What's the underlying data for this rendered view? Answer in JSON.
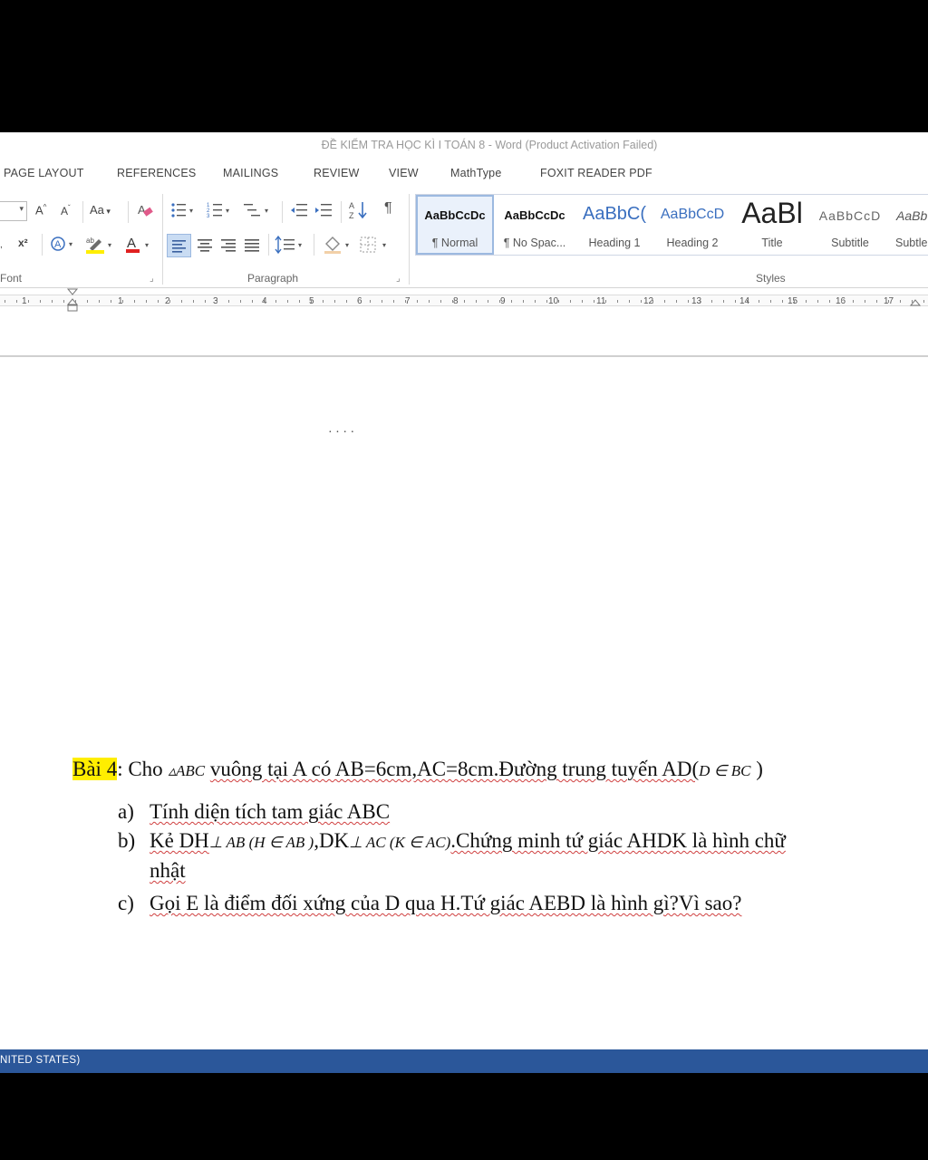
{
  "window": {
    "title": "ĐỀ KIỂM TRA HỌC KÌ I TOÁN 8 - Word (Product Activation Failed)"
  },
  "tabs": [
    "PAGE LAYOUT",
    "REFERENCES",
    "MAILINGS",
    "REVIEW",
    "VIEW",
    "MathType",
    "FOXIT READER PDF"
  ],
  "ribbon": {
    "font_group_label": "Font",
    "paragraph_group_label": "Paragraph",
    "styles_group_label": "Styles",
    "font": {
      "grow_label": "A",
      "shrink_label": "A",
      "case_label": "Aa",
      "subscript_label": "x",
      "superscript_label": "x²"
    },
    "styles": [
      {
        "sample": "AaBbCcDc",
        "name": "¶ Normal"
      },
      {
        "sample": "AaBbCcDc",
        "name": "¶ No Spac..."
      },
      {
        "sample": "AaBbC(",
        "name": "Heading 1"
      },
      {
        "sample": "AaBbCcD",
        "name": "Heading 2"
      },
      {
        "sample": "AaBl",
        "name": "Title"
      },
      {
        "sample": "AaBbCcD",
        "name": "Subtitle"
      },
      {
        "sample": "AaBb",
        "name": "Subtle"
      }
    ]
  },
  "ruler": {
    "numbers": [
      "1",
      "1",
      "2",
      "3",
      "4",
      "5",
      "6",
      "7",
      "8",
      "9",
      "10",
      "11",
      "12",
      "13",
      "14",
      "15",
      "16",
      "17"
    ]
  },
  "document": {
    "problem_label": "Bài 4",
    "intro_prefix": ": Cho ",
    "triangle": "▵ABC",
    "intro_text": " vuông tại A có AB=6cm,AC=8cm.Đường trung tuyến AD(",
    "intro_cond": "D ∈ BC",
    "intro_suffix": ")",
    "a_marker": "a)",
    "a_text": "Tính diện tích tam giác ABC",
    "b_marker": "b)",
    "b_text_1": "Kẻ DH",
    "b_perp_1": "⊥ AB (H ∈ AB )",
    "b_text_2": ",DK",
    "b_perp_2": "⊥ AC (K ∈ AC)",
    "b_text_3": ".Chứng minh tứ giác AHDK là hình chữ",
    "b_text_cont": "nhật",
    "c_marker": "c)",
    "c_text": "Gọi E là điểm đối xứng của D qua H.Tứ giác AEBD là hình gì?Vì sao?"
  },
  "statusbar": {
    "language": "NITED STATES)",
    "color": "#2b579a"
  }
}
